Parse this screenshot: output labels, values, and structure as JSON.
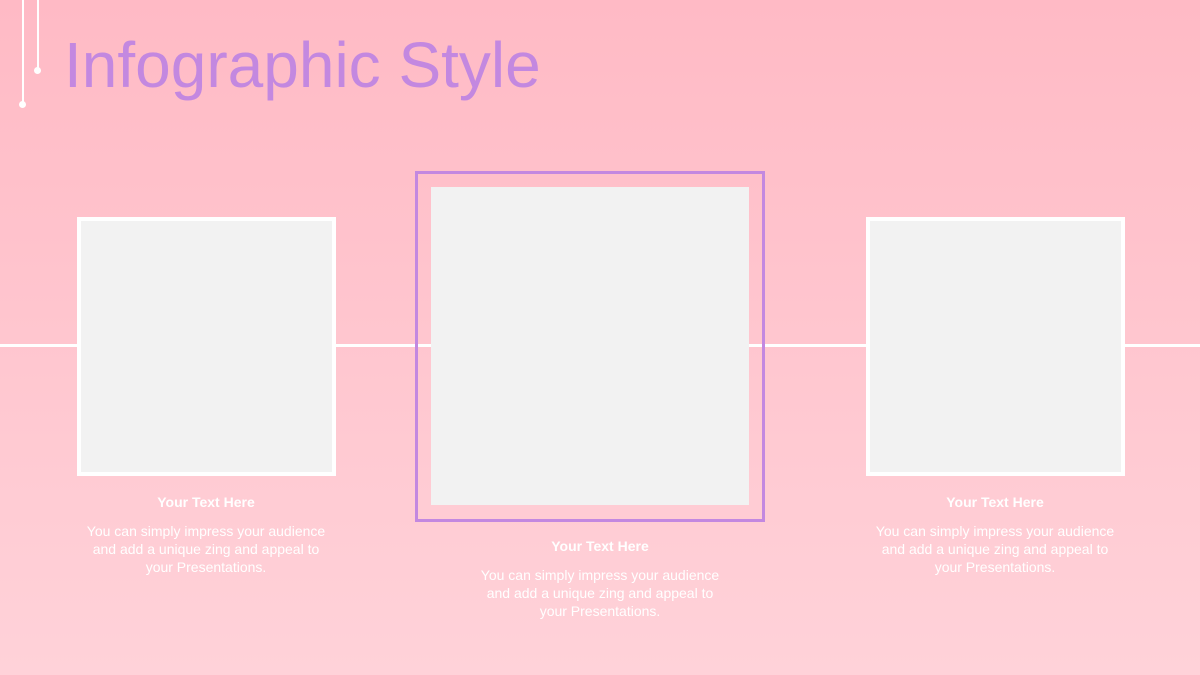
{
  "slide": {
    "title": "Infographic Style"
  },
  "items": [
    {
      "heading": "Your Text  Here",
      "body": "You can simply impress your audience and add a unique zing and appeal to your Presentations."
    },
    {
      "heading": "Your Text  Here",
      "body": "You can simply impress your audience and add a unique zing and appeal to your Presentations."
    },
    {
      "heading": "Your Text  Here",
      "body": "You can simply impress your audience and add a unique zing and appeal to your Presentations."
    }
  ],
  "colors": {
    "accent": "#c388e0",
    "background_top": "#ffbac5",
    "background_bottom": "#ffd2d9",
    "placeholder": "#f2f2f2"
  }
}
